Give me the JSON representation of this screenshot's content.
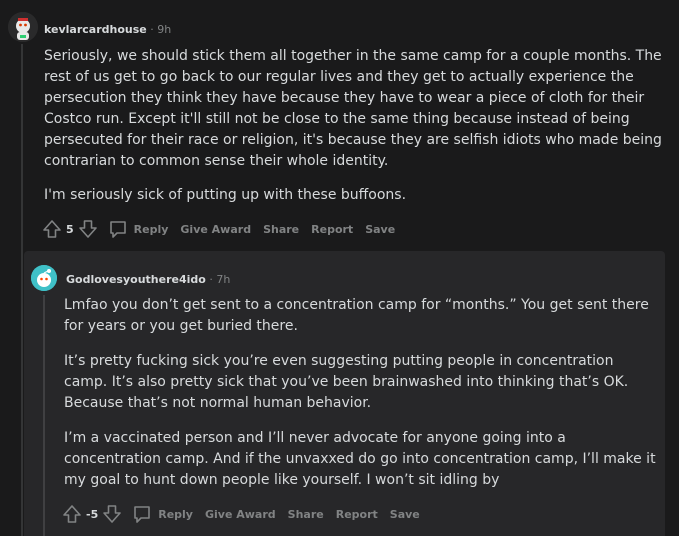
{
  "top_comment": {
    "author": "kevlarcardhouse",
    "separator": "·",
    "time": "9h",
    "paragraphs": [
      "Seriously, we should stick them all together in the same camp for a couple months. The rest of us get to go back to our regular lives and they get to actually experience the persecution they think they have because they have to wear a piece of cloth for their Costco run. Except it'll still not be close to the same thing because instead of being persecuted for their race or religion, it's because they are selfish idiots who made being contrarian to common sense their whole identity.",
      "I'm seriously sick of putting up with these buffoons."
    ],
    "votes": "5",
    "actions": {
      "reply": "Reply",
      "give_award": "Give Award",
      "share": "Share",
      "report": "Report",
      "save": "Save"
    }
  },
  "reply_comment": {
    "author": "Godlovesyouthere4ido",
    "separator": "·",
    "time": "7h",
    "paragraphs": [
      "Lmfao you don’t get sent to a concentration camp for “months.” You get sent there for years or you get buried there.",
      "It’s pretty fucking sick you’re even suggesting putting people in concentration camp. It’s also pretty sick that you’ve been brainwashed into thinking that’s OK. Because that’s not normal human behavior.",
      "I’m a vaccinated person and I’ll never advocate for anyone going into a concentration camp. And if the unvaxxed do go into concentration camp, I’ll make it my goal to hunt down people like yourself. I won’t sit idling by"
    ],
    "votes": "-5",
    "actions": {
      "reply": "Reply",
      "give_award": "Give Award",
      "share": "Share",
      "report": "Report",
      "save": "Save"
    }
  },
  "colors": {
    "background": "#1a1a1b",
    "reply_card": "#272729",
    "text": "#d7dadc",
    "muted": "#818384"
  },
  "icons": {
    "upvote": "upvote-arrow-icon",
    "downvote": "downvote-arrow-icon",
    "reply": "speech-bubble-icon"
  }
}
